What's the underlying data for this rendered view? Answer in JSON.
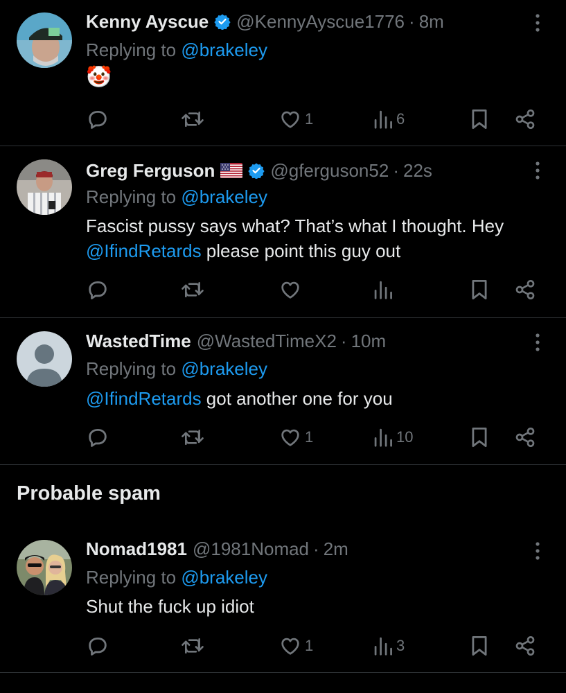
{
  "tweets": [
    {
      "name": "Kenny Ayscue",
      "handle": "@KennyAyscue1776",
      "sep": "·",
      "time": "8m",
      "replying_prefix": "Replying to",
      "replying_to": "@brakeley",
      "body_emoji": "🤡",
      "likes": "1",
      "views": "6"
    },
    {
      "name": "Greg Ferguson",
      "handle": "@gferguson52",
      "sep": "·",
      "time": "22s",
      "replying_prefix": "Replying to",
      "replying_to": "@brakeley",
      "body_line1": "Fascist pussy says what? That’s what I thought. Hey",
      "body_mention": "@IfindRetards",
      "body_rest": " please point this guy out"
    },
    {
      "name": "WastedTime",
      "handle": "@WastedTimeX2",
      "sep": "·",
      "time": "10m",
      "replying_prefix": "Replying to",
      "replying_to": "@brakeley",
      "body_mention": "@IfindRetards",
      "body_rest": " got another one for you",
      "likes": "1",
      "views": "10"
    },
    {
      "name": "Nomad1981",
      "handle": "@1981Nomad",
      "sep": "·",
      "time": "2m",
      "replying_prefix": "Replying to",
      "replying_to": "@brakeley",
      "body": "Shut the fuck up idiot",
      "likes": "1",
      "views": "3"
    }
  ],
  "section": {
    "spam_title": "Probable spam"
  },
  "colors": {
    "background": "#000000",
    "text": "#e7e9ea",
    "muted": "#71767b",
    "accent": "#1d9bf0",
    "divider": "#2f3336"
  },
  "icons": [
    "verified-badge-icon",
    "us-flag-icon",
    "more-options-icon",
    "reply-icon",
    "repost-icon",
    "like-icon",
    "views-icon",
    "bookmark-icon",
    "share-icon"
  ]
}
